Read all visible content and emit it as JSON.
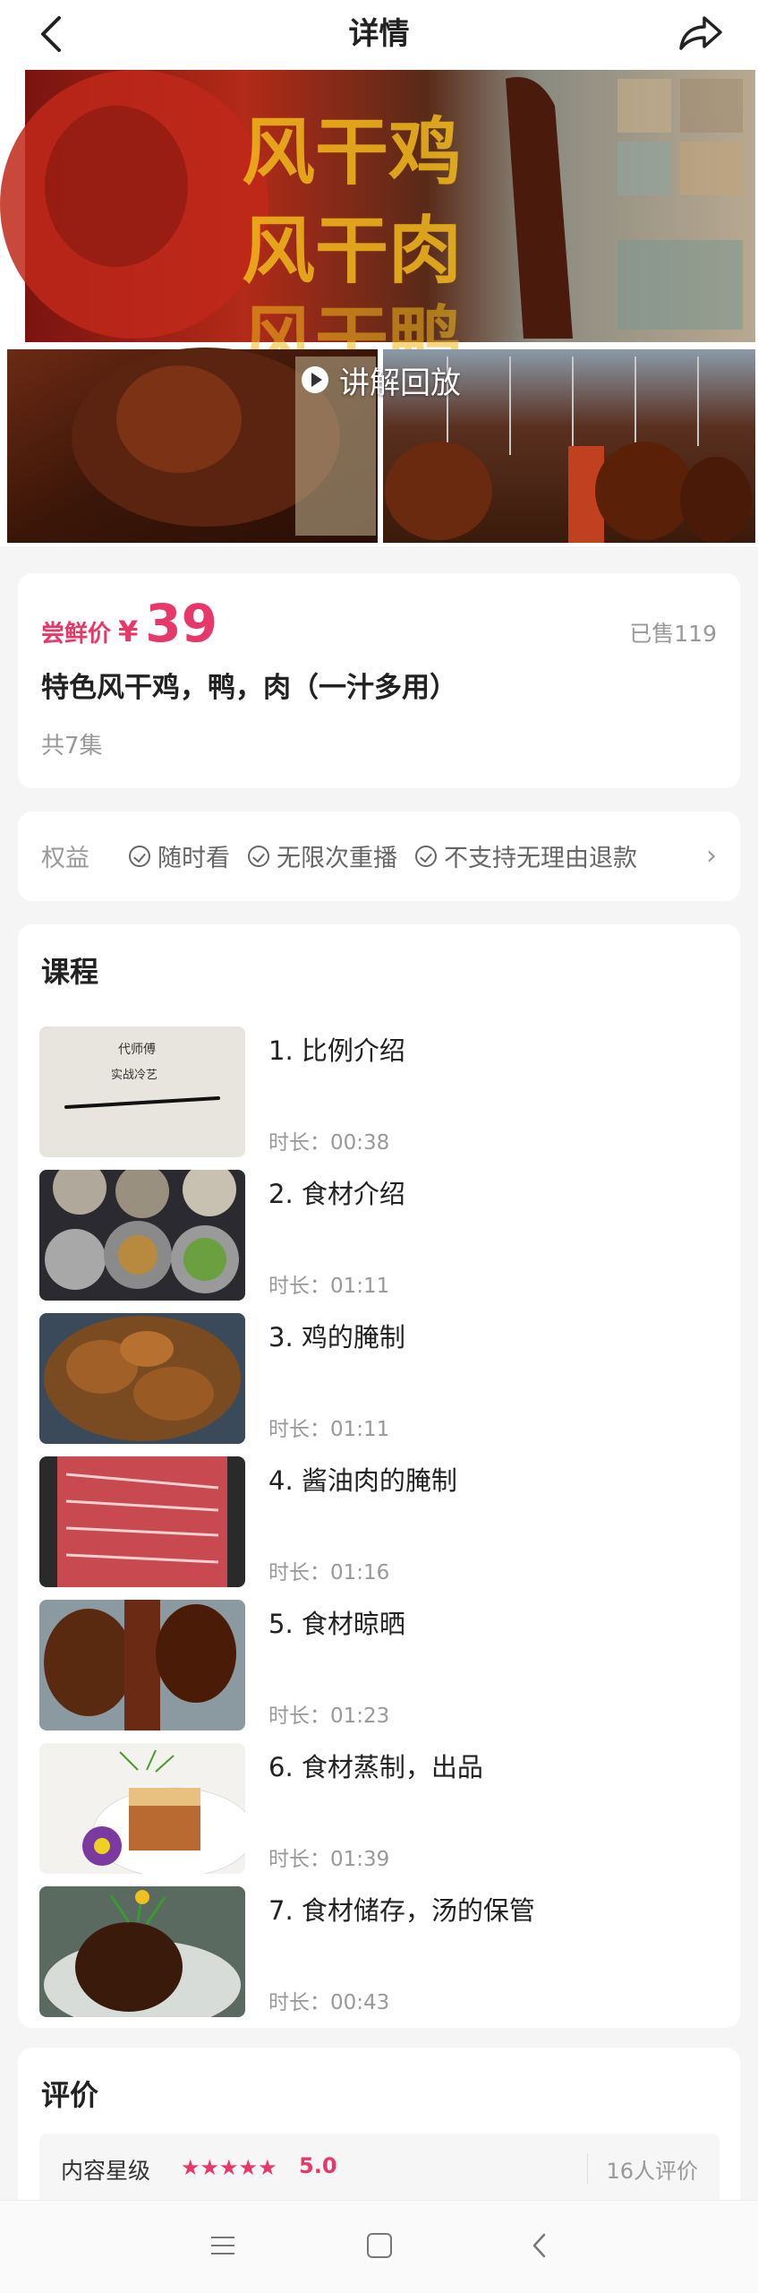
{
  "header": {
    "title": "详情"
  },
  "hero": {
    "banner_lines": [
      "风干鸡",
      "风干肉",
      "风干鸭"
    ],
    "play_label": "讲解回放"
  },
  "product": {
    "price_label": "尝鲜价",
    "currency": "¥",
    "price": "39",
    "sold": "已售119",
    "title": "特色风干鸡，鸭，肉（一汁多用）",
    "episodes": "共7集"
  },
  "rights": {
    "label": "权益",
    "items": [
      "随时看",
      "无限次重播",
      "不支持无理由退款"
    ]
  },
  "lessons_section": {
    "title": "课程",
    "items": [
      {
        "name": "1. 比例介绍",
        "duration": "时长：00:38",
        "thumb_text": [
          "代师傅",
          "实战冷艺"
        ]
      },
      {
        "name": "2. 食材介绍",
        "duration": "时长：01:11"
      },
      {
        "name": "3. 鸡的腌制",
        "duration": "时长：01:11"
      },
      {
        "name": "4. 酱油肉的腌制",
        "duration": "时长：01:16"
      },
      {
        "name": "5. 食材晾晒",
        "duration": "时长：01:23"
      },
      {
        "name": "6. 食材蒸制，出品",
        "duration": "时长：01:39"
      },
      {
        "name": "7. 食材储存，汤的保管",
        "duration": "时长：00:43"
      }
    ]
  },
  "reviews": {
    "title": "评价",
    "rating_label": "内容星级",
    "stars": "★★★★★",
    "score": "5.0",
    "count": "16人评价"
  },
  "colors": {
    "accent": "#e8386a"
  }
}
